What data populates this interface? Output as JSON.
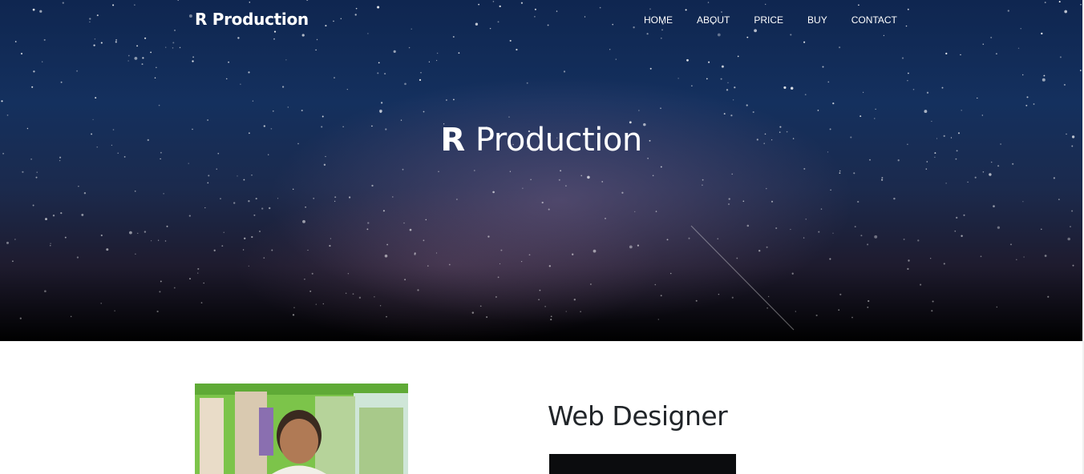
{
  "header": {
    "brand": "R Production",
    "nav": [
      "HOME",
      "ABOUT",
      "PRICE",
      "BUY",
      "CONTACT"
    ]
  },
  "hero": {
    "title_bold": "R",
    "title_rest": "Production"
  },
  "about": {
    "heading": "Web Designer"
  },
  "colors": {
    "hero_top": "#0f2650",
    "hero_bottom": "#000000",
    "heading_text": "#212529"
  }
}
